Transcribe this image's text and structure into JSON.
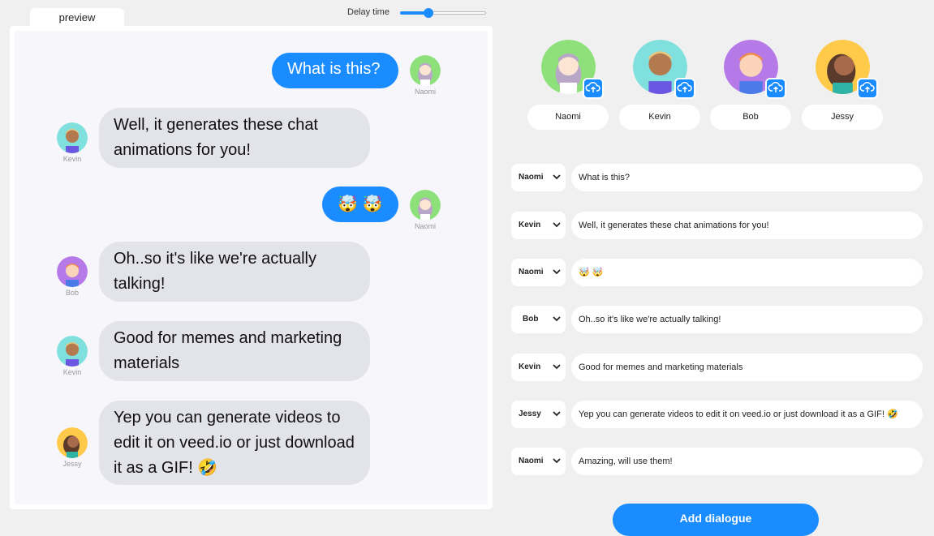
{
  "tab_label": "preview",
  "delay": {
    "label": "Delay time",
    "value_fraction": 0.33
  },
  "colors": {
    "accent": "#1a8cff",
    "them_bubble": "#e3e3ea"
  },
  "preview": {
    "messages": [
      {
        "from": "Naomi",
        "side": "me",
        "text": "What is this?"
      },
      {
        "from": "Kevin",
        "side": "them",
        "text": "Well, it generates these chat animations for you!"
      },
      {
        "from": "Naomi",
        "side": "me",
        "text": "🤯 🤯"
      },
      {
        "from": "Bob",
        "side": "them",
        "text": "Oh..so it's like we're actually talking!"
      },
      {
        "from": "Kevin",
        "side": "them",
        "text": "Good for memes and marketing materials"
      },
      {
        "from": "Jessy",
        "side": "them",
        "text": "Yep you can generate videos to edit it on veed.io or just download it as a GIF! 🤣"
      }
    ]
  },
  "characters": [
    {
      "name": "Naomi",
      "bg": "#8ee07a"
    },
    {
      "name": "Kevin",
      "bg": "#7fe0de"
    },
    {
      "name": "Bob",
      "bg": "#b57ae8"
    },
    {
      "name": "Jessy",
      "bg": "#ffc94a"
    }
  ],
  "script_rows": [
    {
      "speaker": "Naomi",
      "text": "What is this?"
    },
    {
      "speaker": "Kevin",
      "text": "Well, it generates these chat animations for you!"
    },
    {
      "speaker": "Naomi",
      "text": "🤯 🤯"
    },
    {
      "speaker": "Bob",
      "text": "Oh..so it's like we're actually talking!"
    },
    {
      "speaker": "Kevin",
      "text": "Good for memes and marketing materials"
    },
    {
      "speaker": "Jessy",
      "text": "Yep you can generate videos to edit it on veed.io or just download it as a GIF! 🤣"
    },
    {
      "speaker": "Naomi",
      "text": "Amazing, will use them!"
    }
  ],
  "add_button_label": "Add dialogue",
  "icons": {
    "upload": "upload-icon",
    "chevron": "chevron-down-icon"
  }
}
